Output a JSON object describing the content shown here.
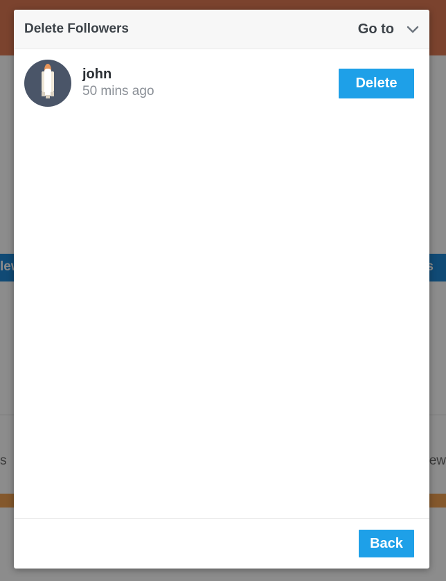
{
  "background": {
    "blue_band_left_text": "lew",
    "blue_band_right_text": "s",
    "gray_left_text": "s",
    "gray_right_text": "iew"
  },
  "modal": {
    "title": "Delete Followers",
    "goto_label": "Go to",
    "followers": [
      {
        "name": "john",
        "time": "50 mins ago",
        "action_label": "Delete",
        "avatar_icon": "rocket-icon"
      }
    ],
    "back_label": "Back"
  },
  "colors": {
    "accent": "#1ea0e8",
    "header_bg": "#f7f7f7",
    "avatar_bg": "#4a5568"
  }
}
